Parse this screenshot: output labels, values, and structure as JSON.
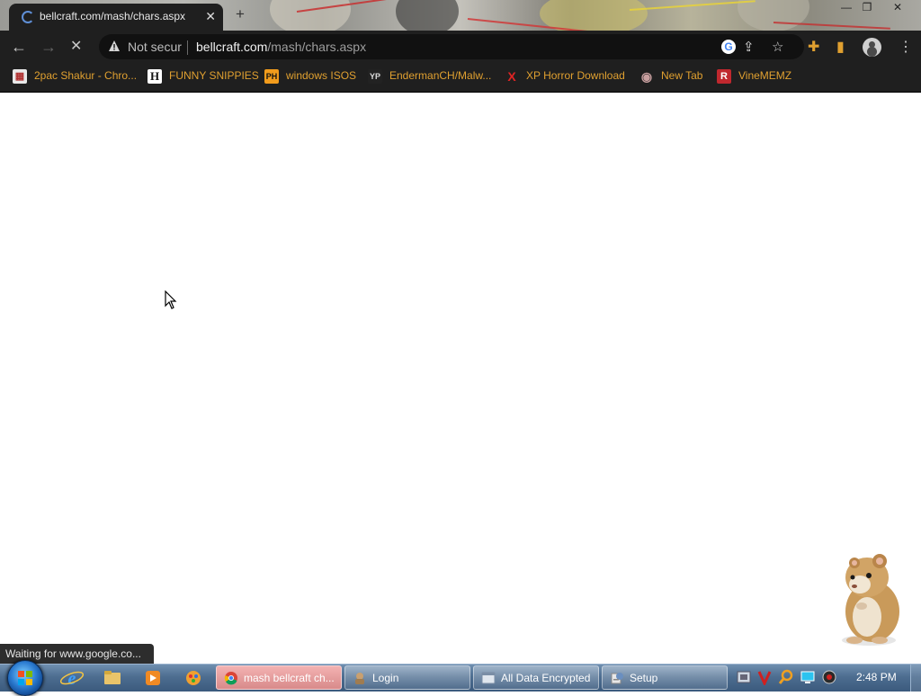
{
  "browser": {
    "tab": {
      "title": "bellcraft.com/mash/chars.aspx",
      "close": "✕"
    },
    "new_tab": "+",
    "window_controls": {
      "minimize": "—",
      "restore": "❐",
      "close": "✕"
    },
    "nav": {
      "back": "←",
      "forward": "→",
      "stop": "✕"
    },
    "omnibox": {
      "security_label": "Not secur",
      "url_host": "bellcraft.com",
      "url_path": "/mash/chars.aspx",
      "warning_icon": "warning-triangle-icon",
      "google_icon": "G"
    },
    "toolbar_icons": {
      "share": "⇪",
      "bookmark": "☆",
      "extensions": "✚",
      "sidepanel": "▮",
      "menu": "⋮"
    }
  },
  "bookmarks": [
    {
      "label": "2pac Shakur - Chro...",
      "icon": "▦",
      "icon_name": "tupac-favicon-icon"
    },
    {
      "label": "FUNNY SNIPPIES",
      "icon": "H",
      "icon_name": "h-logo-icon"
    },
    {
      "label": "windows ISOS",
      "icon": "PH",
      "icon_name": "ph-logo-icon"
    },
    {
      "label": "EndermanCH/Malw...",
      "icon": "YP",
      "icon_name": "yp-logo-icon"
    },
    {
      "label": "XP Horror Download",
      "icon": "X",
      "icon_name": "x-logo-icon"
    },
    {
      "label": "New Tab",
      "icon": "◉",
      "icon_name": "globe-icon"
    },
    {
      "label": "VineMEMZ",
      "icon": "R",
      "icon_name": "r-logo-icon"
    }
  ],
  "page": {
    "status_text": "Waiting for www.google.co..."
  },
  "taskbar": {
    "tasks": [
      {
        "label": "mash bellcraft ch...",
        "active": true
      },
      {
        "label": "Login",
        "active": false
      },
      {
        "label": "All Data Encrypted",
        "active": false
      },
      {
        "label": "Setup",
        "active": false
      }
    ],
    "clock": "2:48 PM"
  },
  "colors": {
    "browser_chrome": "#1f1f1f",
    "bookmark_text": "#e0a030",
    "taskbar": "#4d6d90",
    "active_task": "#d88a8a"
  }
}
